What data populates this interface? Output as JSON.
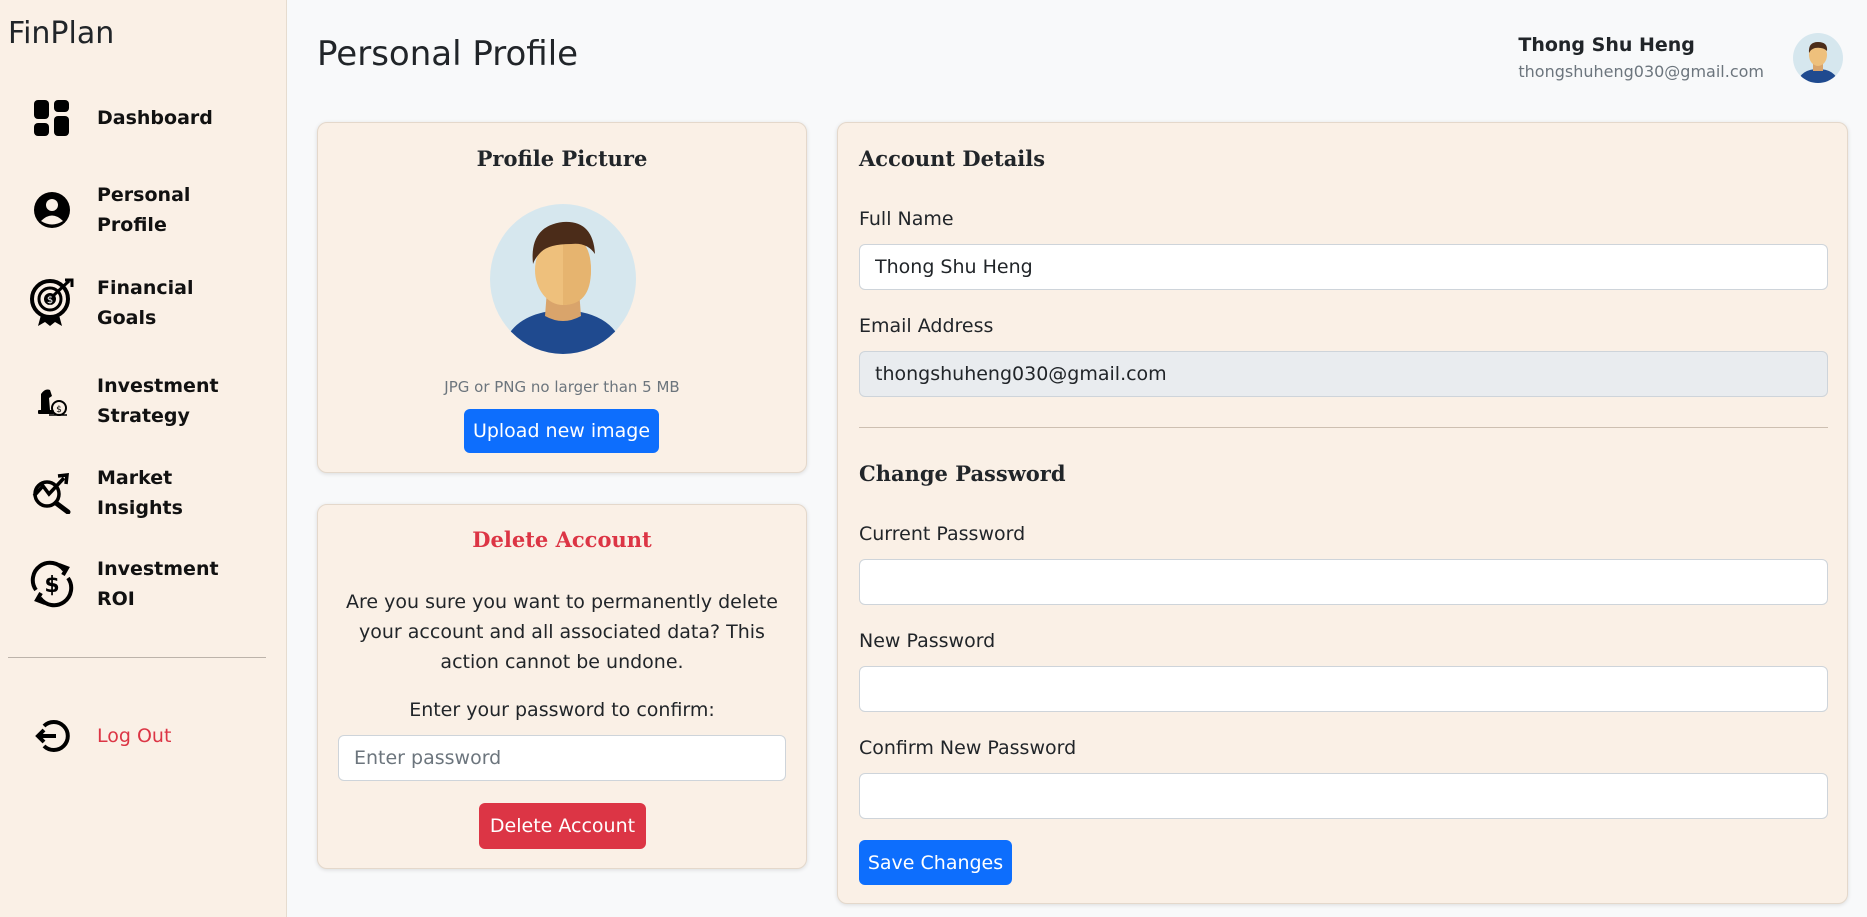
{
  "app": {
    "brand": "FinPlan"
  },
  "sidebar": {
    "items": [
      {
        "label": "Dashboard",
        "icon": "dashboard-icon"
      },
      {
        "label": "Personal Profile",
        "icon": "person-circle-icon"
      },
      {
        "label": "Financial Goals",
        "icon": "target-dollar-icon"
      },
      {
        "label": "Investment Strategy",
        "icon": "strategy-icon"
      },
      {
        "label": "Market Insights",
        "icon": "chart-magnifier-icon"
      },
      {
        "label": "Investment ROI",
        "icon": "dollar-cycle-icon"
      }
    ],
    "logout": {
      "label": "Log Out",
      "icon": "logout-icon"
    }
  },
  "header": {
    "title": "Personal Profile",
    "user_name": "Thong Shu Heng",
    "user_email": "thongshuheng030@gmail.com"
  },
  "profile_picture": {
    "title": "Profile Picture",
    "hint": "JPG or PNG no larger than 5 MB",
    "upload_label": "Upload new image"
  },
  "delete_account": {
    "title": "Delete Account",
    "warning": "Are you sure you want to permanently delete your account and all associated data? This action cannot be undone.",
    "confirm_label": "Enter your password to confirm:",
    "password_placeholder": "Enter password",
    "button_label": "Delete Account"
  },
  "account_details": {
    "title": "Account Details",
    "full_name_label": "Full Name",
    "full_name_value": "Thong Shu Heng",
    "email_label": "Email Address",
    "email_value": "thongshuheng030@gmail.com"
  },
  "change_password": {
    "title": "Change Password",
    "current_label": "Current Password",
    "new_label": "New Password",
    "confirm_label": "Confirm New Password",
    "save_label": "Save Changes"
  },
  "colors": {
    "sidebar_bg": "#faf0e6",
    "card_bg": "#faf0e6",
    "primary": "#0d6efd",
    "danger": "#dc3545"
  }
}
